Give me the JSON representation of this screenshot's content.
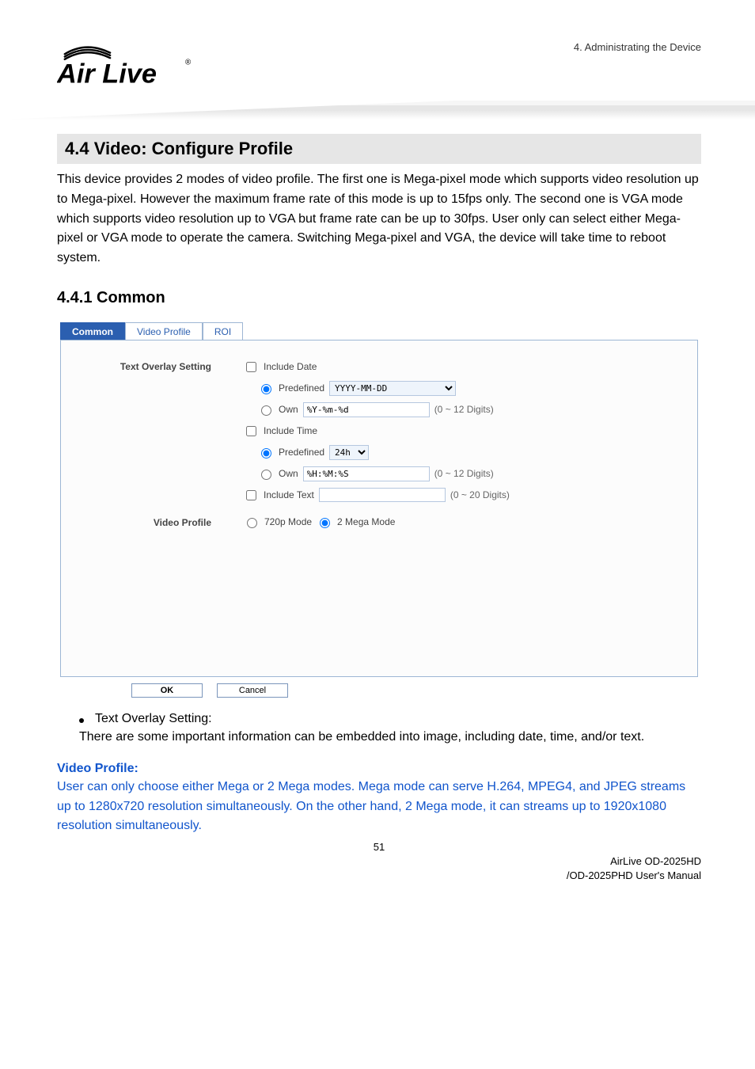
{
  "header": {
    "chapter": "4. Administrating the Device"
  },
  "logo": {
    "top_text": "",
    "brand": "Air Live",
    "reg": "®"
  },
  "section": {
    "title": "4.4 Video: Configure Profile",
    "paragraph": "This device provides 2 modes of video profile. The first one is Mega-pixel mode which supports video resolution up to Mega-pixel. However the maximum frame rate of this mode is up to 15fps only. The second one is VGA mode which supports video resolution up to VGA but frame rate can be up to 30fps. User only can select either Mega-pixel or VGA mode to operate the camera. Switching Mega-pixel and VGA, the device will take time to reboot system."
  },
  "subsection": {
    "title": "4.4.1  Common"
  },
  "tabs": {
    "common": "Common",
    "video_profile": "Video Profile",
    "roi": "ROI"
  },
  "form": {
    "text_overlay_label": "Text Overlay Setting",
    "include_date": "Include Date",
    "predefined": "Predefined",
    "date_predef_option": "YYYY-MM-DD",
    "own": "Own",
    "date_own_value": "%Y-%m-%d",
    "digits12": "(0 ~ 12 Digits)",
    "include_time": "Include Time",
    "time_predef_option": "24h",
    "time_own_value": "%H:%M:%S",
    "include_text": "Include Text",
    "digits20": "(0 ~ 20 Digits)",
    "video_profile_label": "Video Profile",
    "mode720": "720p Mode",
    "mode2mega": "2 Mega Mode"
  },
  "buttons": {
    "ok": "OK",
    "cancel": "Cancel"
  },
  "after": {
    "bullet_label": "Text Overlay Setting:",
    "bullet_body": "There are some important information can be embedded into image, including date, time, and/or text.",
    "vp_head": "Video Profile:",
    "vp_body": "User can only choose either Mega or 2 Mega modes. Mega mode can serve H.264, MPEG4, and JPEG streams up to 1280x720 resolution simultaneously. On the other hand, 2 Mega mode, it can streams up to 1920x1080 resolution simultaneously."
  },
  "footer": {
    "page": "51",
    "line1": "AirLive OD-2025HD",
    "line2": "/OD-2025PHD User's Manual"
  }
}
